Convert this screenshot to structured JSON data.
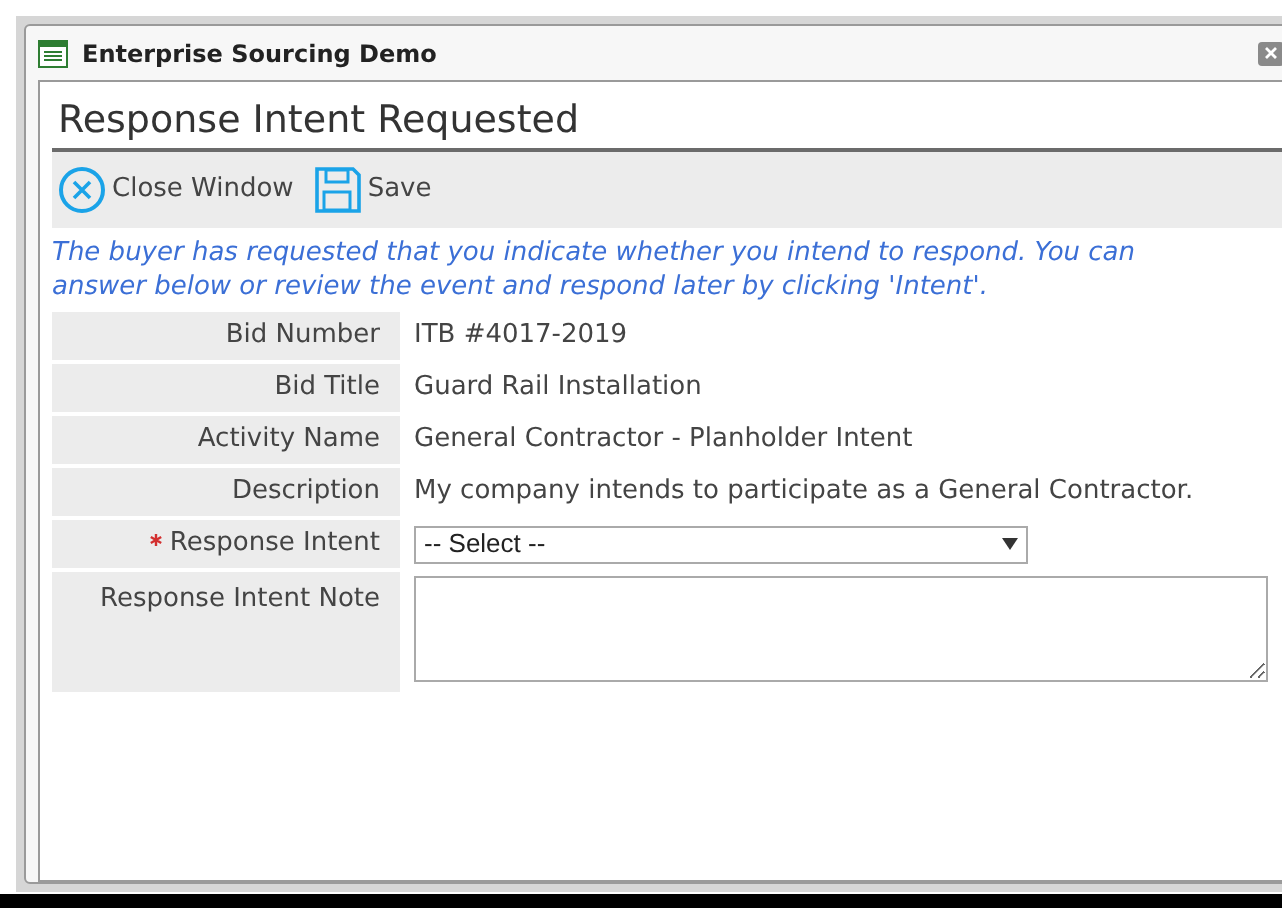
{
  "window": {
    "title": "Enterprise Sourcing Demo"
  },
  "heading": "Response Intent Requested",
  "toolbar": [
    "Close Window",
    "Save"
  ],
  "message": "The buyer has requested that you indicate whether you intend to respond. You can answer below or review the event and respond later by clicking 'Intent'.",
  "fields": [
    {
      "kind": "text",
      "label": "Bid Number",
      "value": "ITB #4017-2019",
      "required": false
    },
    {
      "kind": "text",
      "label": "Bid Title",
      "value": "Guard Rail Installation",
      "required": false
    },
    {
      "kind": "text",
      "label": "Activity Name",
      "value": "General Contractor - Planholder Intent",
      "required": false
    },
    {
      "kind": "text",
      "label": "Description",
      "value": "My company intends to participate as a General Contractor.",
      "required": false
    },
    {
      "kind": "select",
      "label": "Response Intent",
      "value": "-- Select --",
      "required": true
    },
    {
      "kind": "textarea",
      "label": "Response Intent Note",
      "required": false
    }
  ]
}
